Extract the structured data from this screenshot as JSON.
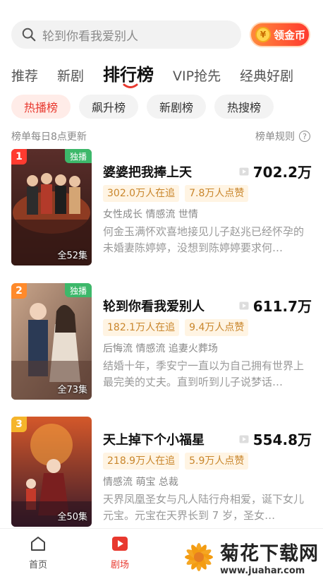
{
  "search": {
    "placeholder": "轮到你看我爱别人",
    "coin_label": "领金币",
    "coin_icon": "¥"
  },
  "tabs": [
    {
      "label": "推荐"
    },
    {
      "label": "新剧"
    },
    {
      "label": "排行榜"
    },
    {
      "label": "VIP抢先"
    },
    {
      "label": "经典好剧"
    }
  ],
  "chips": [
    {
      "label": "热播榜"
    },
    {
      "label": "飙升榜"
    },
    {
      "label": "新剧榜"
    },
    {
      "label": "热搜榜"
    }
  ],
  "info": {
    "update_note": "榜单每日8点更新",
    "rules_label": "榜单规则",
    "rules_icon": "?"
  },
  "items": [
    {
      "rank": "1",
      "badge_color": "#ff3b30",
      "exclusive": "独播",
      "episodes": "全52集",
      "poster_text": "婆婆把我捧上天",
      "title": "婆婆把我捧上天",
      "heat": "702.2万",
      "tag_watching": "302.0万人在追",
      "tag_likes": "7.8万人点赞",
      "genres": "女性成长 情感流 世情",
      "desc": "何金玉满怀欢喜地接见儿子赵兆已经怀孕的未婚妻陈婷婷，没想到陈婷婷要求何…"
    },
    {
      "rank": "2",
      "badge_color": "#ff8a2b",
      "exclusive": "独播",
      "episodes": "全73集",
      "poster_text": "轮到你看我爱别人",
      "title": "轮到你看我爱别人",
      "heat": "611.7万",
      "tag_watching": "182.1万人在追",
      "tag_likes": "9.4万人点赞",
      "genres": "后悔流 情感流 追妻火葬场",
      "desc": "结婚十年，季安宁一直以为自己拥有世界上最完美的丈夫。直到听到儿子说梦话…"
    },
    {
      "rank": "3",
      "badge_color": "#f5b52a",
      "exclusive": "",
      "episodes": "全50集",
      "poster_text": "天上掉下个小福星",
      "title": "天上掉下个小福星",
      "heat": "554.8万",
      "tag_watching": "218.9万人在追",
      "tag_likes": "5.9万人点赞",
      "genres": "情感流 萌宝 总裁",
      "desc": "天界凤凰圣女与凡人陆行舟相爱，诞下女儿元宝。元宝在天界长到 7 岁，圣女…"
    }
  ],
  "nav": [
    {
      "label": "首页",
      "icon": "home-icon"
    },
    {
      "label": "剧场",
      "icon": "theater-icon"
    }
  ],
  "watermark": {
    "name": "菊花下载网",
    "url": "www.juahar.com"
  },
  "colors": {
    "accent": "#e8382e",
    "tag_bg": "#fff4e3",
    "tag_text": "#c9862c",
    "exclusive": "#3db86a"
  }
}
